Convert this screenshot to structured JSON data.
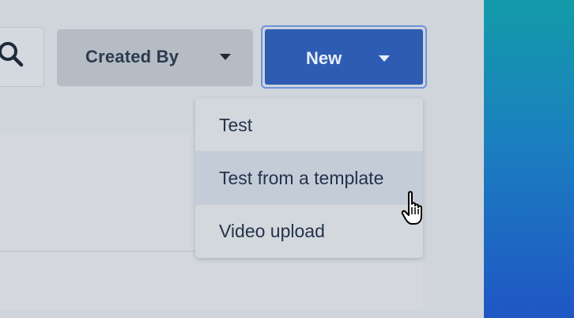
{
  "toolbar": {
    "search_icon": "search-icon",
    "created_by_label": "Created By",
    "new_label": "New"
  },
  "new_menu": {
    "items": [
      {
        "label": "Test",
        "hovered": false
      },
      {
        "label": "Test from a template",
        "hovered": true
      },
      {
        "label": "Video upload",
        "hovered": false
      }
    ]
  },
  "colors": {
    "primary_button": "#2f5cb3",
    "secondary_button": "#b5bcc4",
    "menu_hover": "#c4ccd8",
    "gradient_top": "#139ba9",
    "gradient_bottom": "#1f56c4"
  },
  "cursor": "pointer-hand-icon"
}
